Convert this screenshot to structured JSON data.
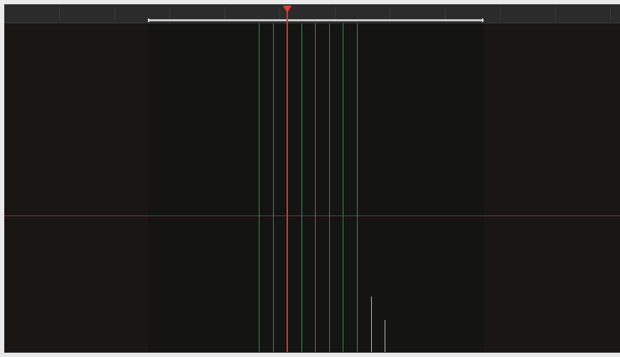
{
  "viewer": {
    "name": "timeline viewer",
    "colors": {
      "panel_background": "#191614",
      "ruler_background": "#2b2b2c",
      "playhead": "#e33d31",
      "guide_green": "#1f9a57",
      "horizontal_guide": "#7a2f49",
      "white_marker": "#bdbdbd"
    }
  }
}
